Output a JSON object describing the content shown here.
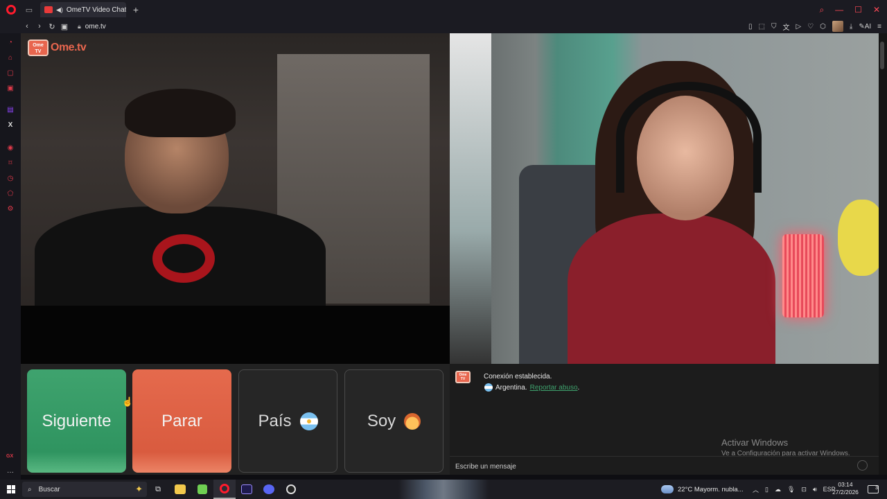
{
  "browser": {
    "tab_title": "OmeTV Video Chat — :",
    "url": "ome.tv",
    "ai_label": "AI",
    "new_tab": "+"
  },
  "sidebar": {
    "gx_label": "GX",
    "more": "···"
  },
  "video": {
    "logo_box": "Ome TV",
    "logo_text": "Ome.tv"
  },
  "controls": {
    "next_label": "Siguiente",
    "stop_label": "Parar",
    "country_label": "País",
    "gender_label": "Soy"
  },
  "chat": {
    "logo_box": "Ome TV",
    "status": "Conexión establecida.",
    "country": "Argentina.",
    "report_link": "Reportar abuso",
    "report_suffix": ".",
    "input_placeholder": "Escribe un mensaje"
  },
  "watermark": {
    "title": "Activar Windows",
    "subtitle": "Ve a Configuración para activar Windows."
  },
  "taskbar": {
    "search_placeholder": "Buscar",
    "weather": "22°C  Mayorm. nubla...",
    "language": "ESP",
    "time": "03:14",
    "date": "27/2/2026",
    "notifications": "3"
  }
}
